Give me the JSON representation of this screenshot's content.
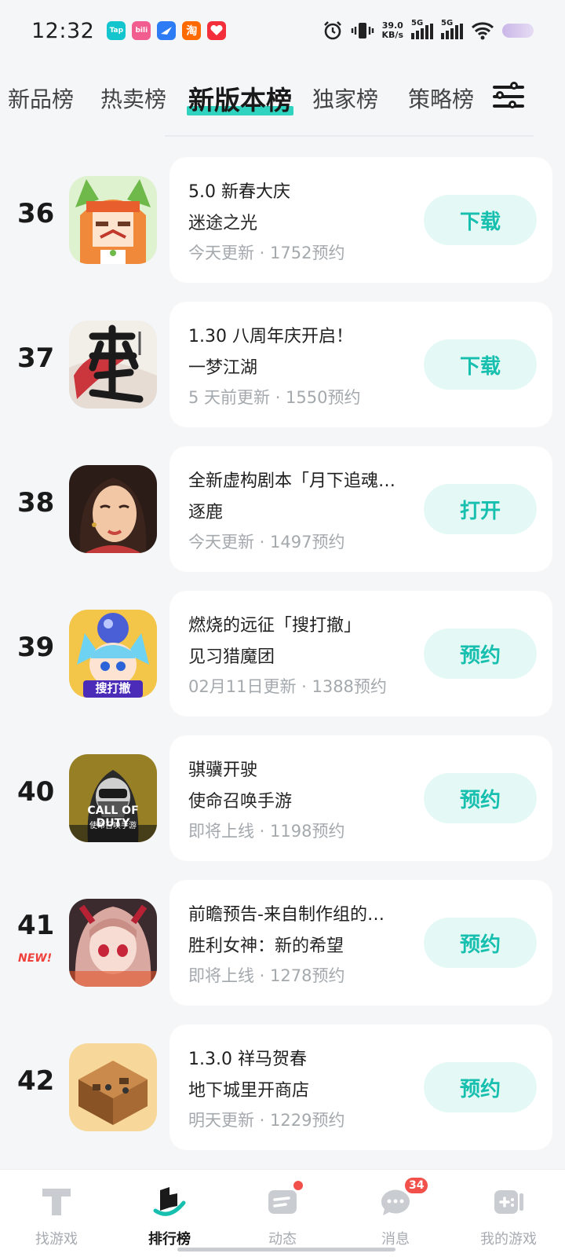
{
  "status_bar": {
    "time": "12:32",
    "notifications": [
      {
        "name": "taptap-notification-icon",
        "label": "Tap",
        "color": "#15c5ce"
      },
      {
        "name": "bilibili-notification-icon",
        "label": "bili",
        "color": "#f05d8e"
      },
      {
        "name": "feishu-notification-icon",
        "label": "",
        "color": "#2d7cf6"
      },
      {
        "name": "taobao-notification-icon",
        "label": "淘",
        "color": "#ff6a00"
      },
      {
        "name": "redapp-notification-icon",
        "label": "",
        "color": "#f22f3a"
      }
    ],
    "net_speed_value": "39.0",
    "net_speed_unit": "KB/s",
    "sim1": "5G",
    "sim2": "5G"
  },
  "tabs": [
    {
      "label": "新品榜",
      "active": false
    },
    {
      "label": "热卖榜",
      "active": false
    },
    {
      "label": "新版本榜",
      "active": true
    },
    {
      "label": "独家榜",
      "active": false
    },
    {
      "label": "策略榜",
      "active": false
    }
  ],
  "accent_color": "#16bfae",
  "games": [
    {
      "rank": "36",
      "new": "",
      "title": "5.0 新春大庆",
      "name": "迷途之光",
      "meta": "今天更新 · 1752预约",
      "button": "下载",
      "icon": "pixel-fox-girl-icon"
    },
    {
      "rank": "37",
      "new": "",
      "title": "1.30 八周年庆开启！",
      "name": "一梦江湖",
      "meta": "5 天前更新 · 1550预约",
      "button": "下载",
      "icon": "calligraphy-logo-icon"
    },
    {
      "rank": "38",
      "new": "",
      "title": "全新虚构剧本「月下追魂…",
      "name": "逐鹿",
      "meta": "今天更新 · 1497预约",
      "button": "打开",
      "icon": "ancient-lady-portrait-icon"
    },
    {
      "rank": "39",
      "new": "",
      "title": "燃烧的远征「搜打撤」",
      "name": "见习猎魔团",
      "meta": "02月11日更新 · 1388预约",
      "button": "预约",
      "icon": "anime-fox-girl-icon",
      "icon_text": "搜打撤"
    },
    {
      "rank": "40",
      "new": "",
      "title": "骐骥开驶",
      "name": "使命召唤手游",
      "meta": "即将上线 · 1198预约",
      "button": "预约",
      "icon": "call-of-duty-icon",
      "icon_text": "CALL OF DUTY",
      "icon_subtext": "使命召唤手游"
    },
    {
      "rank": "41",
      "new": "NEW!",
      "title": "前瞻预告-来自制作组的…",
      "name": "胜利女神：新的希望",
      "meta": "即将上线 · 1278预约",
      "button": "预约",
      "icon": "anime-red-eye-girl-icon"
    },
    {
      "rank": "42",
      "new": "",
      "title": "1.3.0 祥马贺春",
      "name": "地下城里开商店",
      "meta": "明天更新 · 1229预约",
      "button": "预约",
      "icon": "isometric-shop-room-icon"
    }
  ],
  "bottom_nav": [
    {
      "label": "找游戏",
      "icon": "find-game-icon",
      "active": false
    },
    {
      "label": "排行榜",
      "icon": "ranking-icon",
      "active": true
    },
    {
      "label": "动态",
      "icon": "feed-icon",
      "active": false,
      "dot": true
    },
    {
      "label": "消息",
      "icon": "message-icon",
      "active": false,
      "badge": "34"
    },
    {
      "label": "我的游戏",
      "icon": "my-games-icon",
      "active": false
    }
  ]
}
